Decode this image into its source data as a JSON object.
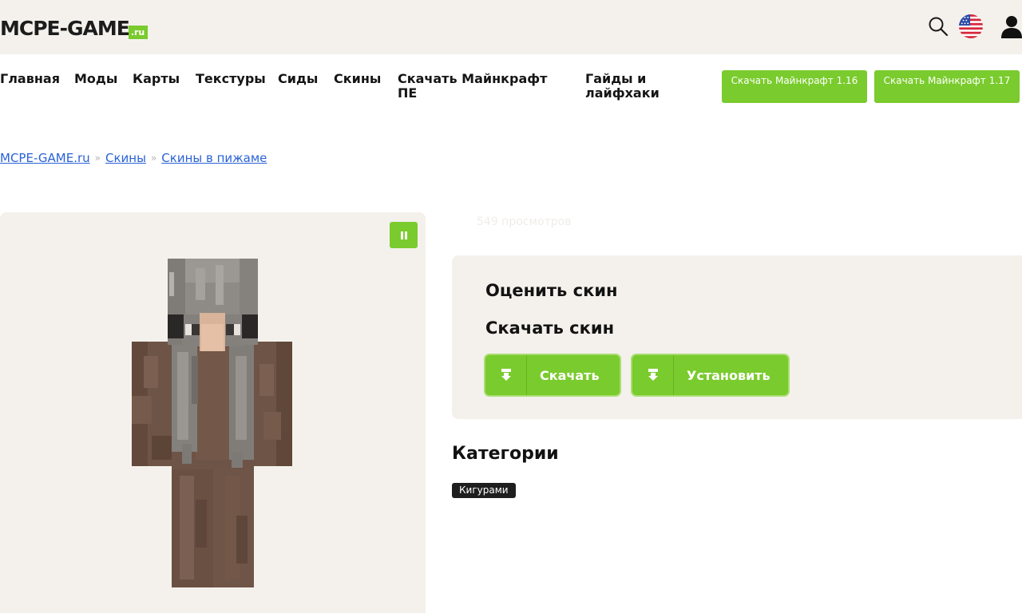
{
  "header": {
    "logo_main": "MCPE-GAME",
    "logo_ru": ".ru",
    "icons": [
      "search-icon",
      "us-flag-icon",
      "user-icon"
    ]
  },
  "nav": {
    "items": [
      {
        "label": "Главная"
      },
      {
        "label": "Моды"
      },
      {
        "label": "Карты"
      },
      {
        "label": "Текстуры"
      },
      {
        "label": "Сиды"
      },
      {
        "label": "Скины"
      },
      {
        "label": "Скачать Майнкрафт ПЕ"
      },
      {
        "label": "Гайды и лайфхаки"
      }
    ],
    "buttons": [
      {
        "label": "Скачать Майнкрафт 1.16"
      },
      {
        "label": "Скачать Майнкрафт 1.17"
      }
    ]
  },
  "breadcrumb": {
    "items": [
      "MCPE-GAME.ru",
      "Скины",
      "Скины в пижаме"
    ],
    "separator": "»"
  },
  "preview": {
    "pause_icon": "pause-icon"
  },
  "content": {
    "views": "549 просмотров",
    "rate_title": "Оценить скин",
    "download_title": "Скачать скин",
    "download_button": "Скачать",
    "install_button": "Установить",
    "categories_title": "Категории",
    "tags": [
      "Кигурами"
    ]
  },
  "colors": {
    "accent": "#7acb2d",
    "panel_bg": "#f4f1ec",
    "link": "#2a62d6",
    "tag_bg": "#1e1e1e"
  }
}
